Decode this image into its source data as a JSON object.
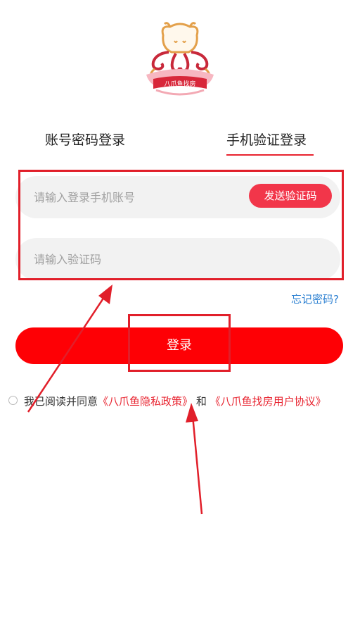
{
  "logo": {
    "banner_text": "八爪鱼找房"
  },
  "tabs": [
    {
      "label": "账号密码登录"
    },
    {
      "label": "手机验证登录"
    }
  ],
  "phone_field": {
    "placeholder": "请输入登录手机账号",
    "value": ""
  },
  "send_code_button": {
    "label": "发送验证码"
  },
  "code_field": {
    "placeholder": "请输入验证码",
    "value": ""
  },
  "forgot_password": {
    "label": "忘记密码?"
  },
  "login_button": {
    "label": "登录"
  },
  "agreement": {
    "prefix": "我已阅读并同意",
    "privacy_link": "《八爪鱼隐私政策》",
    "conjunction": "和",
    "user_agreement_link": "《八爪鱼找房用户协议》"
  },
  "colors": {
    "accent": "#fe0005",
    "send_code_bg": "#f2364a",
    "link_blue": "#2a7fd1",
    "input_bg": "#f2f2f2",
    "annotation_red": "#e11f2a"
  }
}
